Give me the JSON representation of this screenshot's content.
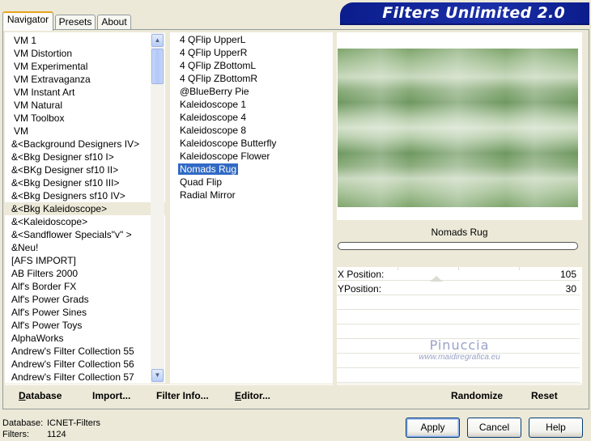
{
  "window": {
    "title": "Filters Unlimited 2.0"
  },
  "tabs": [
    {
      "label": "Navigator",
      "active": true
    },
    {
      "label": "Presets",
      "active": false
    },
    {
      "label": "About",
      "active": false
    }
  ],
  "categories": {
    "items": [
      "VM 1",
      "VM Distortion",
      "VM Experimental",
      "VM Extravaganza",
      "VM Instant Art",
      "VM Natural",
      "VM Toolbox",
      "VM",
      "&<Background Designers IV>",
      "&<Bkg Designer sf10 I>",
      "&<BKg Designer sf10 II>",
      "&<Bkg Designer sf10 III>",
      "&<Bkg Designers sf10 IV>",
      "&<Bkg Kaleidoscope>",
      "&<Kaleidoscope>",
      "&<Sandflower Specials\"v\" >",
      "&Neu!",
      "[AFS IMPORT]",
      "AB Filters 2000",
      "Alf's Border FX",
      "Alf's Power Grads",
      "Alf's Power Sines",
      "Alf's Power Toys",
      "AlphaWorks",
      "Andrew's Filter Collection 55",
      "Andrew's Filter Collection 56",
      "Andrew's Filter Collection 57"
    ],
    "selected": "&<Bkg Kaleidoscope>"
  },
  "filters": {
    "items": [
      "4 QFlip UpperL",
      "4 QFlip UpperR",
      "4 QFlip ZBottomL",
      "4 QFlip ZBottomR",
      "@BlueBerry Pie",
      "Kaleidoscope 1",
      "Kaleidoscope 4",
      "Kaleidoscope 8",
      "Kaleidoscope Butterfly",
      "Kaleidoscope Flower",
      "Nomads Rug",
      "Quad Flip",
      "Radial Mirror"
    ],
    "selected": "Nomads Rug"
  },
  "preview": {
    "filter_name": "Nomads Rug",
    "progress": 0
  },
  "parameters": [
    {
      "label": "X Position:",
      "value": "105"
    },
    {
      "label": "YPosition:",
      "value": "30"
    }
  ],
  "watermark": {
    "line1": "Pinuccia",
    "line2": "www.maidiregrafica.eu"
  },
  "toolbar_left": {
    "database": "Database",
    "import": "Import...",
    "filter_info": "Filter Info...",
    "editor": "Editor..."
  },
  "toolbar_right": {
    "randomize": "Randomize",
    "reset": "Reset"
  },
  "status": {
    "database_label": "Database:",
    "database_value": "ICNET-Filters",
    "filters_label": "Filters:",
    "filters_value": "1124"
  },
  "buttons": {
    "apply": "Apply",
    "cancel": "Cancel",
    "help": "Help"
  },
  "colors": {
    "banner": "#1b2fa8",
    "selection": "#316ac5",
    "face": "#ece9d8"
  }
}
